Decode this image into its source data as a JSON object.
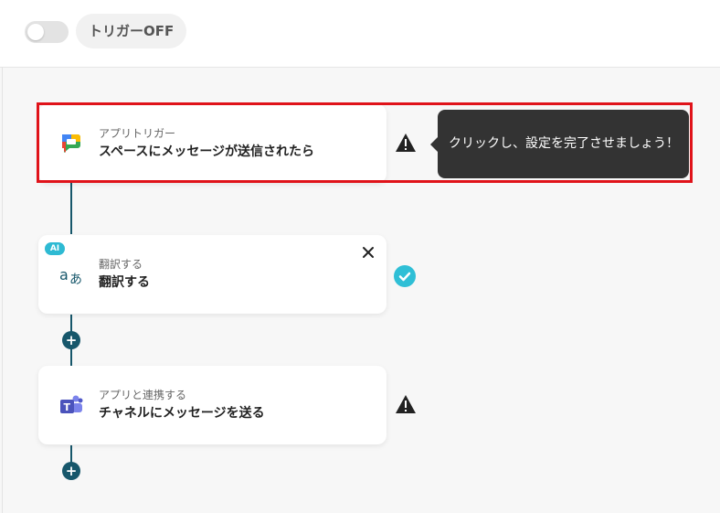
{
  "header": {
    "trigger_label": "トリガーOFF",
    "trigger_on": false
  },
  "steps": [
    {
      "subtitle": "アプリトリガー",
      "title": "スペースにメッセージが送信されたら",
      "icon": "google-chat-icon",
      "status": "warning"
    },
    {
      "badge": "AI",
      "subtitle": "翻訳する",
      "title": "翻訳する",
      "icon": "translate-icon",
      "status": "complete"
    },
    {
      "subtitle": "アプリと連携する",
      "title": "チャネルにメッセージを送る",
      "icon": "microsoft-teams-icon",
      "status": "warning"
    }
  ],
  "tooltip": {
    "text": "クリックし、設定を完了させましょう！"
  },
  "icons": {
    "add": "+",
    "close": "×"
  },
  "colors": {
    "connector": "#17576b",
    "highlight": "#e0131a",
    "check": "#2fbfd6",
    "ai_badge": "#2ebad3"
  }
}
